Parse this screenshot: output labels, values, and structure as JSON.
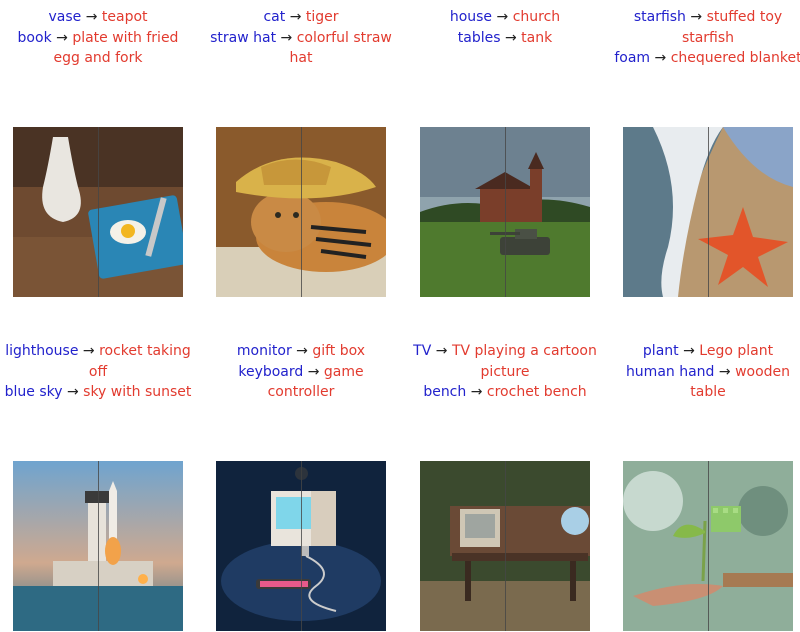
{
  "examples": [
    {
      "edits": [
        {
          "src": "vase",
          "tgt": "teapot"
        },
        {
          "src": "book",
          "tgt": "plate with fried egg and fork"
        }
      ]
    },
    {
      "edits": [
        {
          "src": "cat",
          "tgt": "tiger"
        },
        {
          "src": "straw hat",
          "tgt": "colorful straw hat"
        }
      ]
    },
    {
      "edits": [
        {
          "src": "house",
          "tgt": "church"
        },
        {
          "src": "tables",
          "tgt": "tank"
        }
      ]
    },
    {
      "edits": [
        {
          "src": "starfish",
          "tgt": "stuffed toy starfish"
        },
        {
          "src": "foam",
          "tgt": "chequered blanket"
        }
      ]
    },
    {
      "edits": [
        {
          "src": "lighthouse",
          "tgt": "rocket taking off"
        },
        {
          "src": "blue sky",
          "tgt": "sky with sunset"
        }
      ]
    },
    {
      "edits": [
        {
          "src": "monitor",
          "tgt": "gift box"
        },
        {
          "src": "keyboard",
          "tgt": "game controller"
        }
      ]
    },
    {
      "edits": [
        {
          "src": "TV",
          "tgt": "TV playing a cartoon picture"
        },
        {
          "src": "bench",
          "tgt": "crochet bench"
        }
      ]
    },
    {
      "edits": [
        {
          "src": "plant",
          "tgt": "Lego plant"
        },
        {
          "src": "human hand",
          "tgt": "wooden table"
        }
      ]
    }
  ],
  "arrow_glyph": "→",
  "colors": {
    "source": "#2222cc",
    "target": "#e23b2f"
  },
  "image_icons": [
    "teapot-plate-image",
    "cat-tiger-image",
    "church-tank-image",
    "starfish-blanket-image",
    "rocket-lighthouse-image",
    "giftbox-monitor-image",
    "tv-bench-image",
    "lego-plant-image"
  ]
}
